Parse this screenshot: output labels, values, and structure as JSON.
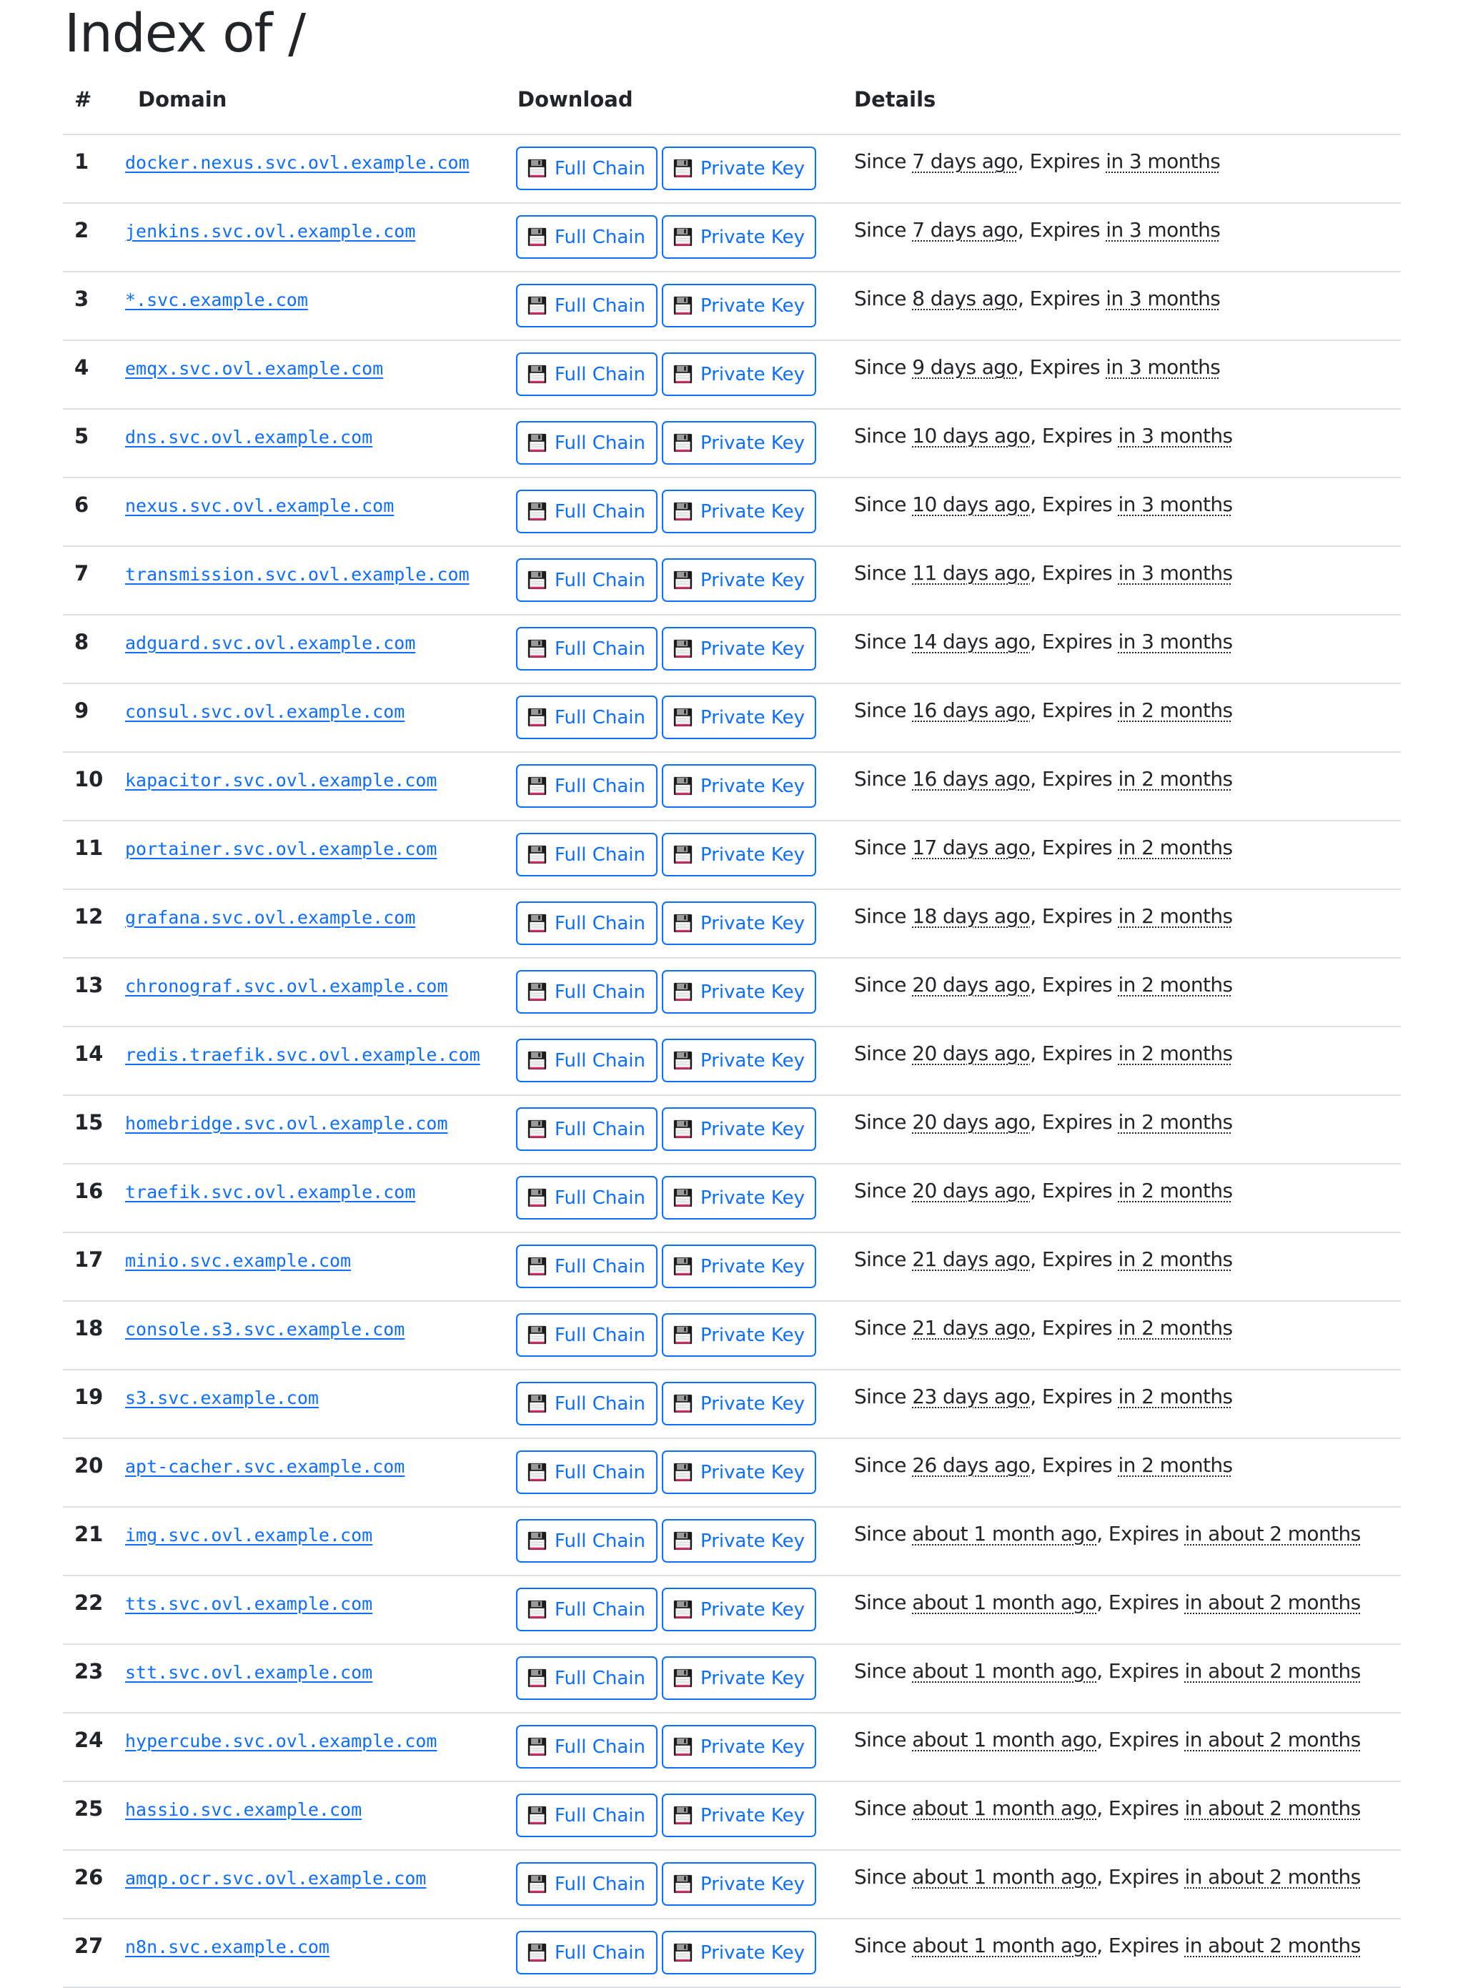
{
  "page": {
    "title": "Index of /"
  },
  "table": {
    "headers": {
      "num": "#",
      "domain": "Domain",
      "download": "Download",
      "details": "Details"
    },
    "labels": {
      "full_chain": "Full Chain",
      "private_key": "Private Key",
      "since_prefix": "Since",
      "expires_prefix": "Expires",
      "download_icon": "floppy-disk-icon"
    },
    "rows": [
      {
        "num": "1",
        "domain": "docker.nexus.svc.ovl.example.com",
        "since": "7 days ago",
        "expires": "in 3 months"
      },
      {
        "num": "2",
        "domain": "jenkins.svc.ovl.example.com",
        "since": "7 days ago",
        "expires": "in 3 months"
      },
      {
        "num": "3",
        "domain": "*.svc.example.com",
        "since": "8 days ago",
        "expires": "in 3 months"
      },
      {
        "num": "4",
        "domain": "emqx.svc.ovl.example.com",
        "since": "9 days ago",
        "expires": "in 3 months"
      },
      {
        "num": "5",
        "domain": "dns.svc.ovl.example.com",
        "since": "10 days ago",
        "expires": "in 3 months"
      },
      {
        "num": "6",
        "domain": "nexus.svc.ovl.example.com",
        "since": "10 days ago",
        "expires": "in 3 months"
      },
      {
        "num": "7",
        "domain": "transmission.svc.ovl.example.com",
        "since": "11 days ago",
        "expires": "in 3 months"
      },
      {
        "num": "8",
        "domain": "adguard.svc.ovl.example.com",
        "since": "14 days ago",
        "expires": "in 3 months"
      },
      {
        "num": "9",
        "domain": "consul.svc.ovl.example.com",
        "since": "16 days ago",
        "expires": "in 2 months"
      },
      {
        "num": "10",
        "domain": "kapacitor.svc.ovl.example.com",
        "since": "16 days ago",
        "expires": "in 2 months"
      },
      {
        "num": "11",
        "domain": "portainer.svc.ovl.example.com",
        "since": "17 days ago",
        "expires": "in 2 months"
      },
      {
        "num": "12",
        "domain": "grafana.svc.ovl.example.com",
        "since": "18 days ago",
        "expires": "in 2 months"
      },
      {
        "num": "13",
        "domain": "chronograf.svc.ovl.example.com",
        "since": "20 days ago",
        "expires": "in 2 months"
      },
      {
        "num": "14",
        "domain": "redis.traefik.svc.ovl.example.com",
        "since": "20 days ago",
        "expires": "in 2 months"
      },
      {
        "num": "15",
        "domain": "homebridge.svc.ovl.example.com",
        "since": "20 days ago",
        "expires": "in 2 months"
      },
      {
        "num": "16",
        "domain": "traefik.svc.ovl.example.com",
        "since": "20 days ago",
        "expires": "in 2 months"
      },
      {
        "num": "17",
        "domain": "minio.svc.example.com",
        "since": "21 days ago",
        "expires": "in 2 months"
      },
      {
        "num": "18",
        "domain": "console.s3.svc.example.com",
        "since": "21 days ago",
        "expires": "in 2 months"
      },
      {
        "num": "19",
        "domain": "s3.svc.example.com",
        "since": "23 days ago",
        "expires": "in 2 months"
      },
      {
        "num": "20",
        "domain": "apt-cacher.svc.example.com",
        "since": "26 days ago",
        "expires": "in 2 months"
      },
      {
        "num": "21",
        "domain": "img.svc.ovl.example.com",
        "since": "about 1 month ago",
        "expires": "in about 2 months"
      },
      {
        "num": "22",
        "domain": "tts.svc.ovl.example.com",
        "since": "about 1 month ago",
        "expires": "in about 2 months"
      },
      {
        "num": "23",
        "domain": "stt.svc.ovl.example.com",
        "since": "about 1 month ago",
        "expires": "in about 2 months"
      },
      {
        "num": "24",
        "domain": "hypercube.svc.ovl.example.com",
        "since": "about 1 month ago",
        "expires": "in about 2 months"
      },
      {
        "num": "25",
        "domain": "hassio.svc.example.com",
        "since": "about 1 month ago",
        "expires": "in about 2 months"
      },
      {
        "num": "26",
        "domain": "amqp.ocr.svc.ovl.example.com",
        "since": "about 1 month ago",
        "expires": "in about 2 months"
      },
      {
        "num": "27",
        "domain": "n8n.svc.example.com",
        "since": "about 1 month ago",
        "expires": "in about 2 months"
      }
    ]
  },
  "colors": {
    "text": "#212529",
    "link": "#0d6efd",
    "border": "#dee2e6",
    "background": "#ffffff"
  }
}
